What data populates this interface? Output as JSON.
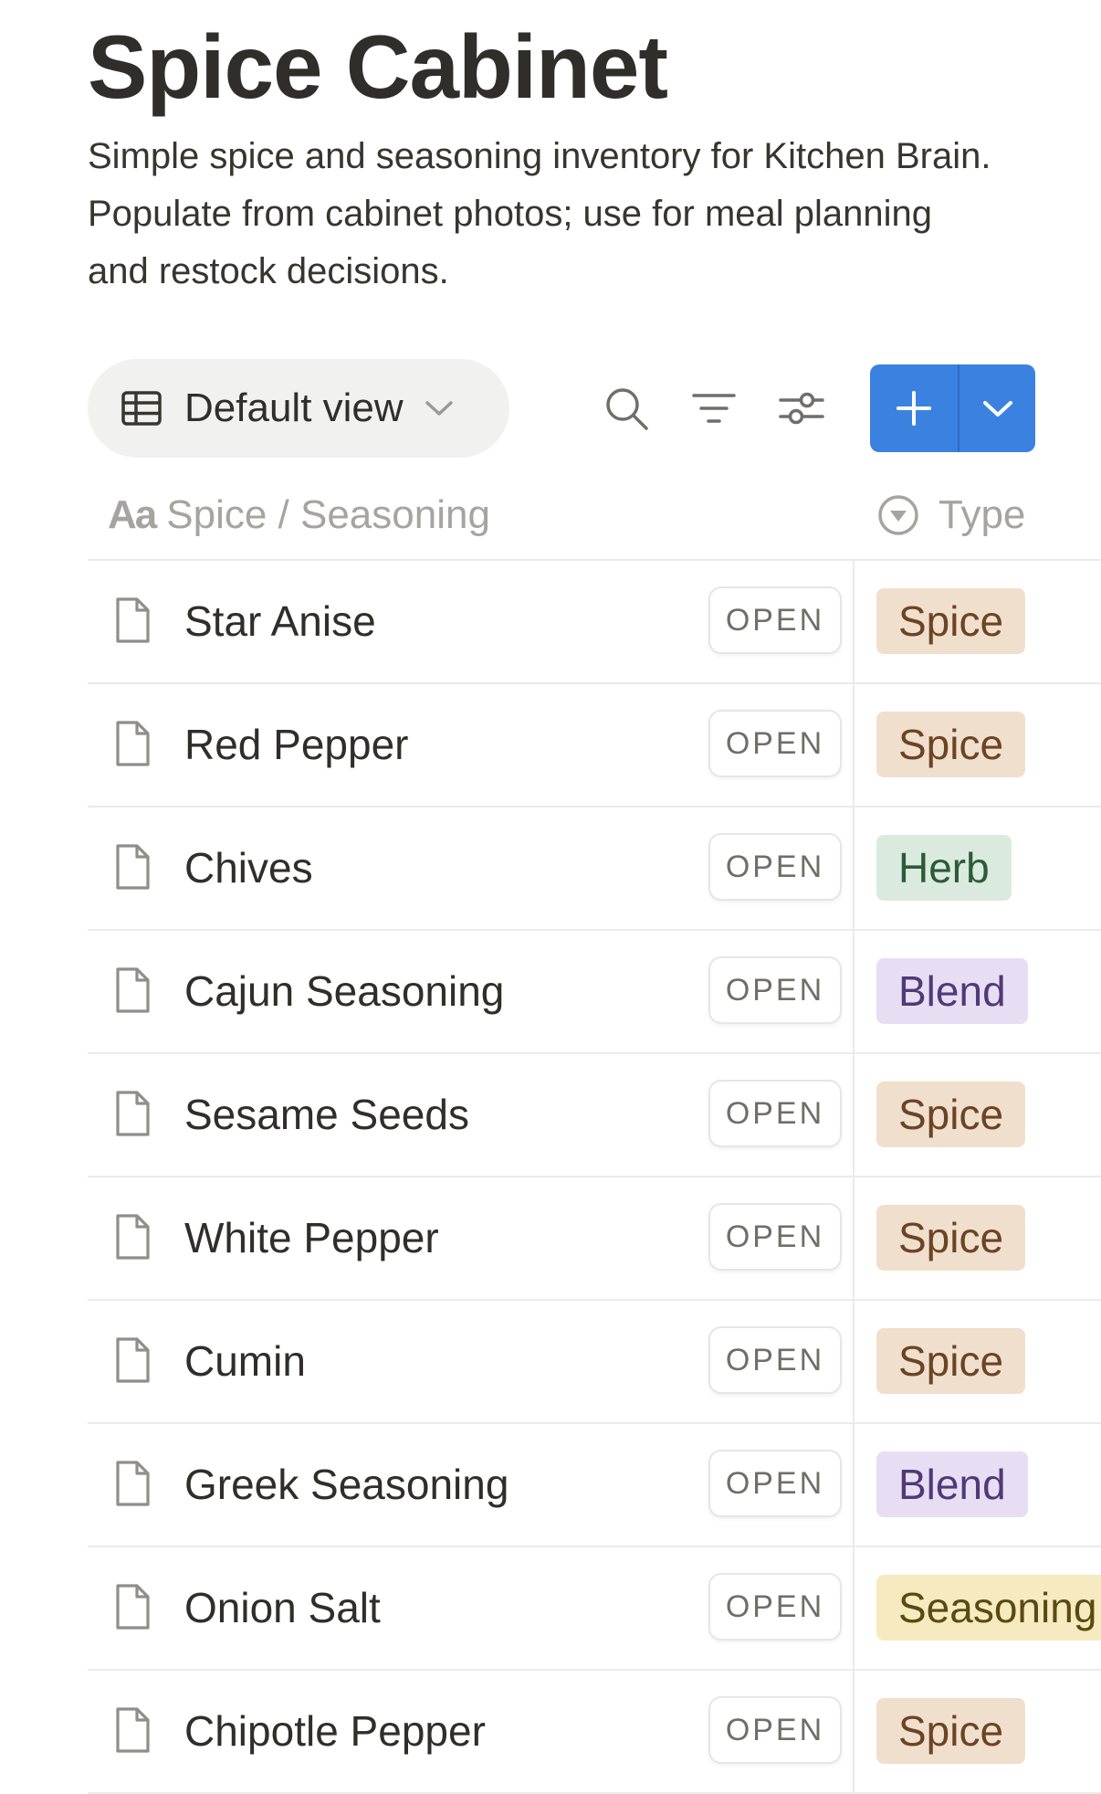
{
  "page": {
    "title": "Spice Cabinet",
    "description": "Simple spice and seasoning inventory for Kitchen Brain. Populate from cabinet photos; use for meal planning and restock decisions."
  },
  "toolbar": {
    "view_label": "Default view",
    "icons": [
      "search-icon",
      "filter-icon",
      "settings-sliders-icon"
    ],
    "new_button_icon": "plus-icon",
    "new_dropdown_icon": "chevron-down-icon"
  },
  "columns": {
    "name_label": "Spice / Seasoning",
    "name_icon": "Aa",
    "type_label": "Type"
  },
  "open_label": "OPEN",
  "rows": [
    {
      "name": "Star Anise",
      "type": "Spice"
    },
    {
      "name": "Red Pepper",
      "type": "Spice"
    },
    {
      "name": "Chives",
      "type": "Herb"
    },
    {
      "name": "Cajun Seasoning",
      "type": "Blend"
    },
    {
      "name": "Sesame Seeds",
      "type": "Spice"
    },
    {
      "name": "White Pepper",
      "type": "Spice"
    },
    {
      "name": "Cumin",
      "type": "Spice"
    },
    {
      "name": "Greek Seasoning",
      "type": "Blend"
    },
    {
      "name": "Onion Salt",
      "type": "Seasoning"
    },
    {
      "name": "Chipotle Pepper",
      "type": "Spice"
    }
  ],
  "tag_colors": {
    "Spice": {
      "bg": "#f1dfce",
      "fg": "#6b4424"
    },
    "Herb": {
      "bg": "#dbeade",
      "fg": "#2c5a38"
    },
    "Blend": {
      "bg": "#e8def4",
      "fg": "#4f3a78"
    },
    "Seasoning": {
      "bg": "#f6ebc0",
      "fg": "#5a4a12"
    }
  },
  "accent_color": "#3b82e0"
}
